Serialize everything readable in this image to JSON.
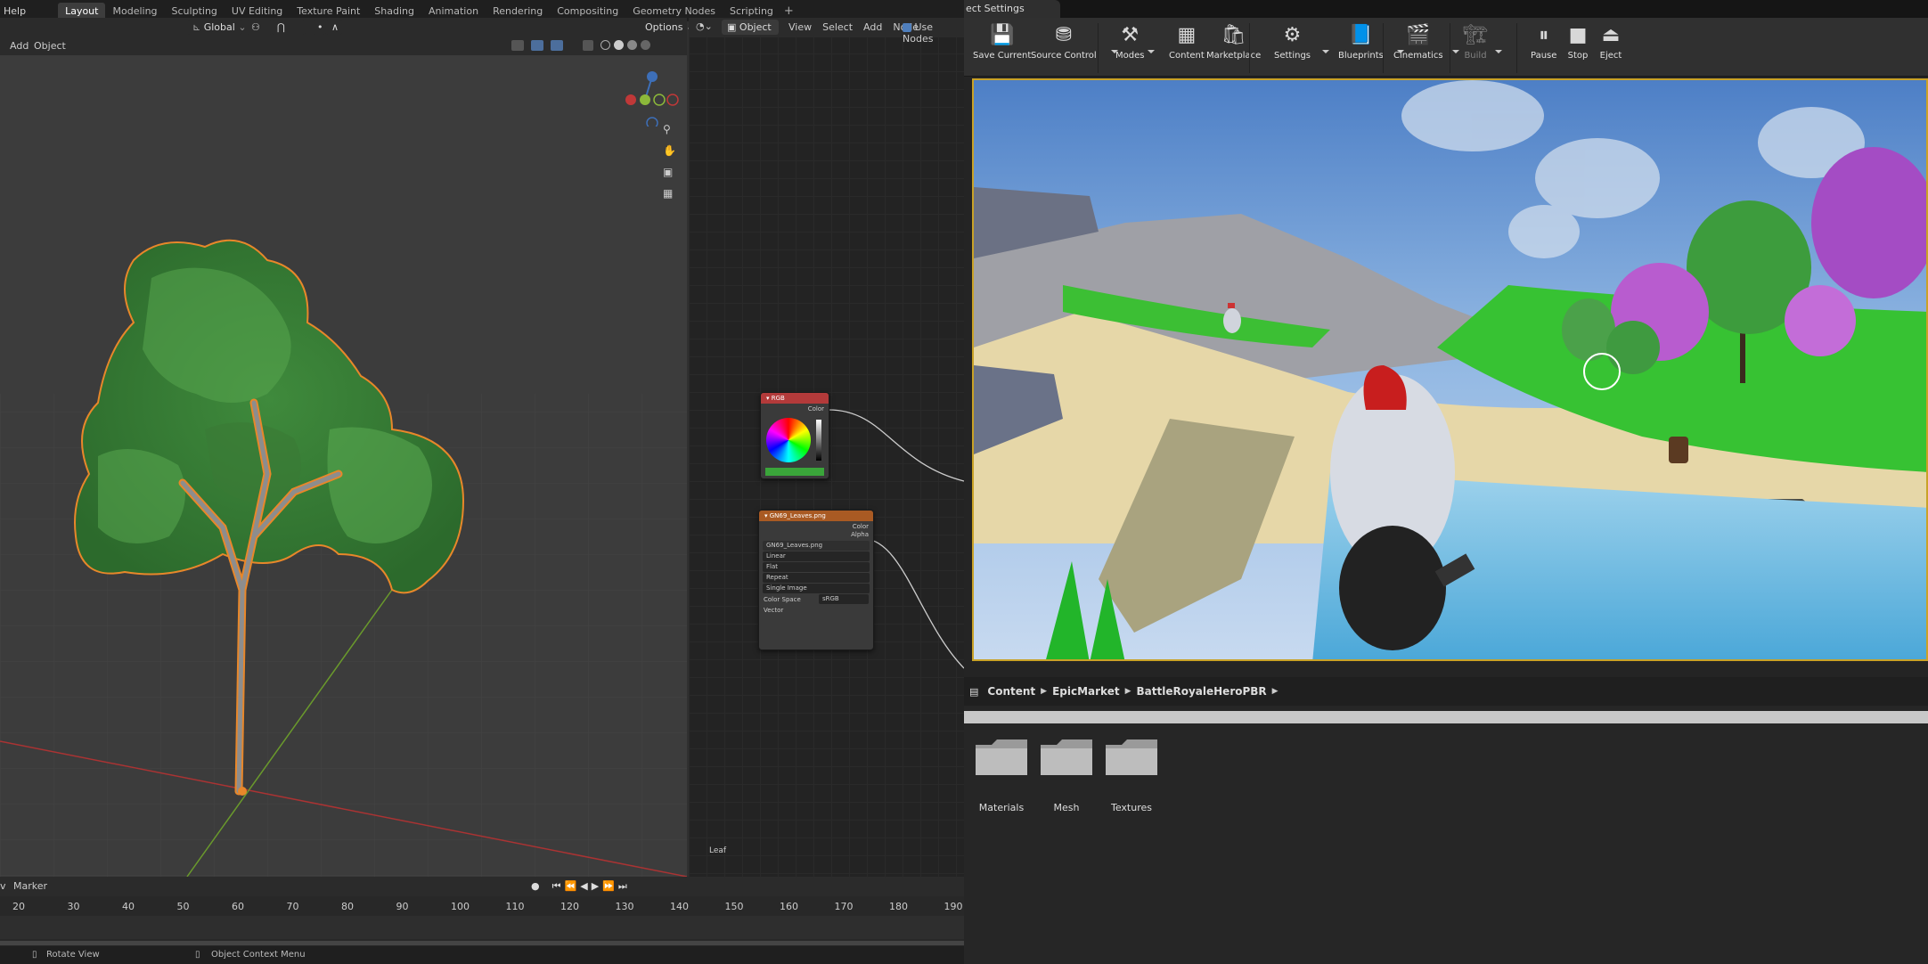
{
  "blender": {
    "menu_help": "Help",
    "workspaces": [
      "Layout",
      "Modeling",
      "Sculpting",
      "UV Editing",
      "Texture Paint",
      "Shading",
      "Animation",
      "Rendering",
      "Compositing",
      "Geometry Nodes",
      "Scripting"
    ],
    "add_workspace": "+",
    "header": {
      "orientation": "Global",
      "options": "Options"
    },
    "viewport_menu": {
      "add": "Add",
      "object": "Object"
    },
    "node_editor": {
      "mode": "Object",
      "menus": [
        "View",
        "Select",
        "Add",
        "Node"
      ],
      "use_nodes": "Use Nodes",
      "frame_label": "Leaf",
      "rgb_node": {
        "title": "RGB",
        "output": "Color"
      },
      "image_node": {
        "title": "GN69_Leaves.png",
        "outputs": [
          "Color",
          "Alpha"
        ],
        "image_name": "GN69_Leaves.png",
        "interpolation": "Linear",
        "projection": "Flat",
        "extension": "Repeat",
        "source": "Single Image",
        "color_space_label": "Color Space",
        "color_space": "sRGB",
        "input": "Vector"
      }
    },
    "timeline": {
      "view_label": "v",
      "marker": "Marker",
      "ticks": [
        "20",
        "30",
        "40",
        "50",
        "60",
        "70",
        "80",
        "90",
        "100",
        "110",
        "120",
        "130",
        "140",
        "150",
        "160",
        "170",
        "180",
        "190"
      ]
    },
    "status": {
      "rotate": "Rotate View",
      "context_menu": "Object Context Menu"
    }
  },
  "unreal": {
    "tab_title": "ect Settings",
    "toolbar": [
      {
        "label": "Save Current",
        "icon": "save-icon"
      },
      {
        "label": "Source Control",
        "icon": "source-control-icon"
      },
      {
        "label": "Modes",
        "icon": "modes-icon"
      },
      {
        "label": "Content",
        "icon": "content-icon"
      },
      {
        "label": "Marketplace",
        "icon": "marketplace-icon"
      },
      {
        "label": "Settings",
        "icon": "settings-icon"
      },
      {
        "label": "Blueprints",
        "icon": "blueprints-icon"
      },
      {
        "label": "Cinematics",
        "icon": "cinematics-icon"
      },
      {
        "label": "Build",
        "icon": "build-icon"
      },
      {
        "label": "Pause",
        "icon": "pause-icon"
      },
      {
        "label": "Stop",
        "icon": "stop-icon"
      },
      {
        "label": "Eject",
        "icon": "eject-icon"
      }
    ],
    "breadcrumbs": [
      "Content",
      "EpicMarket",
      "BattleRoyaleHeroPBR"
    ],
    "folders": [
      "Materials",
      "Mesh",
      "Textures"
    ],
    "colors": {
      "viewport_border": "#c9a227"
    }
  }
}
